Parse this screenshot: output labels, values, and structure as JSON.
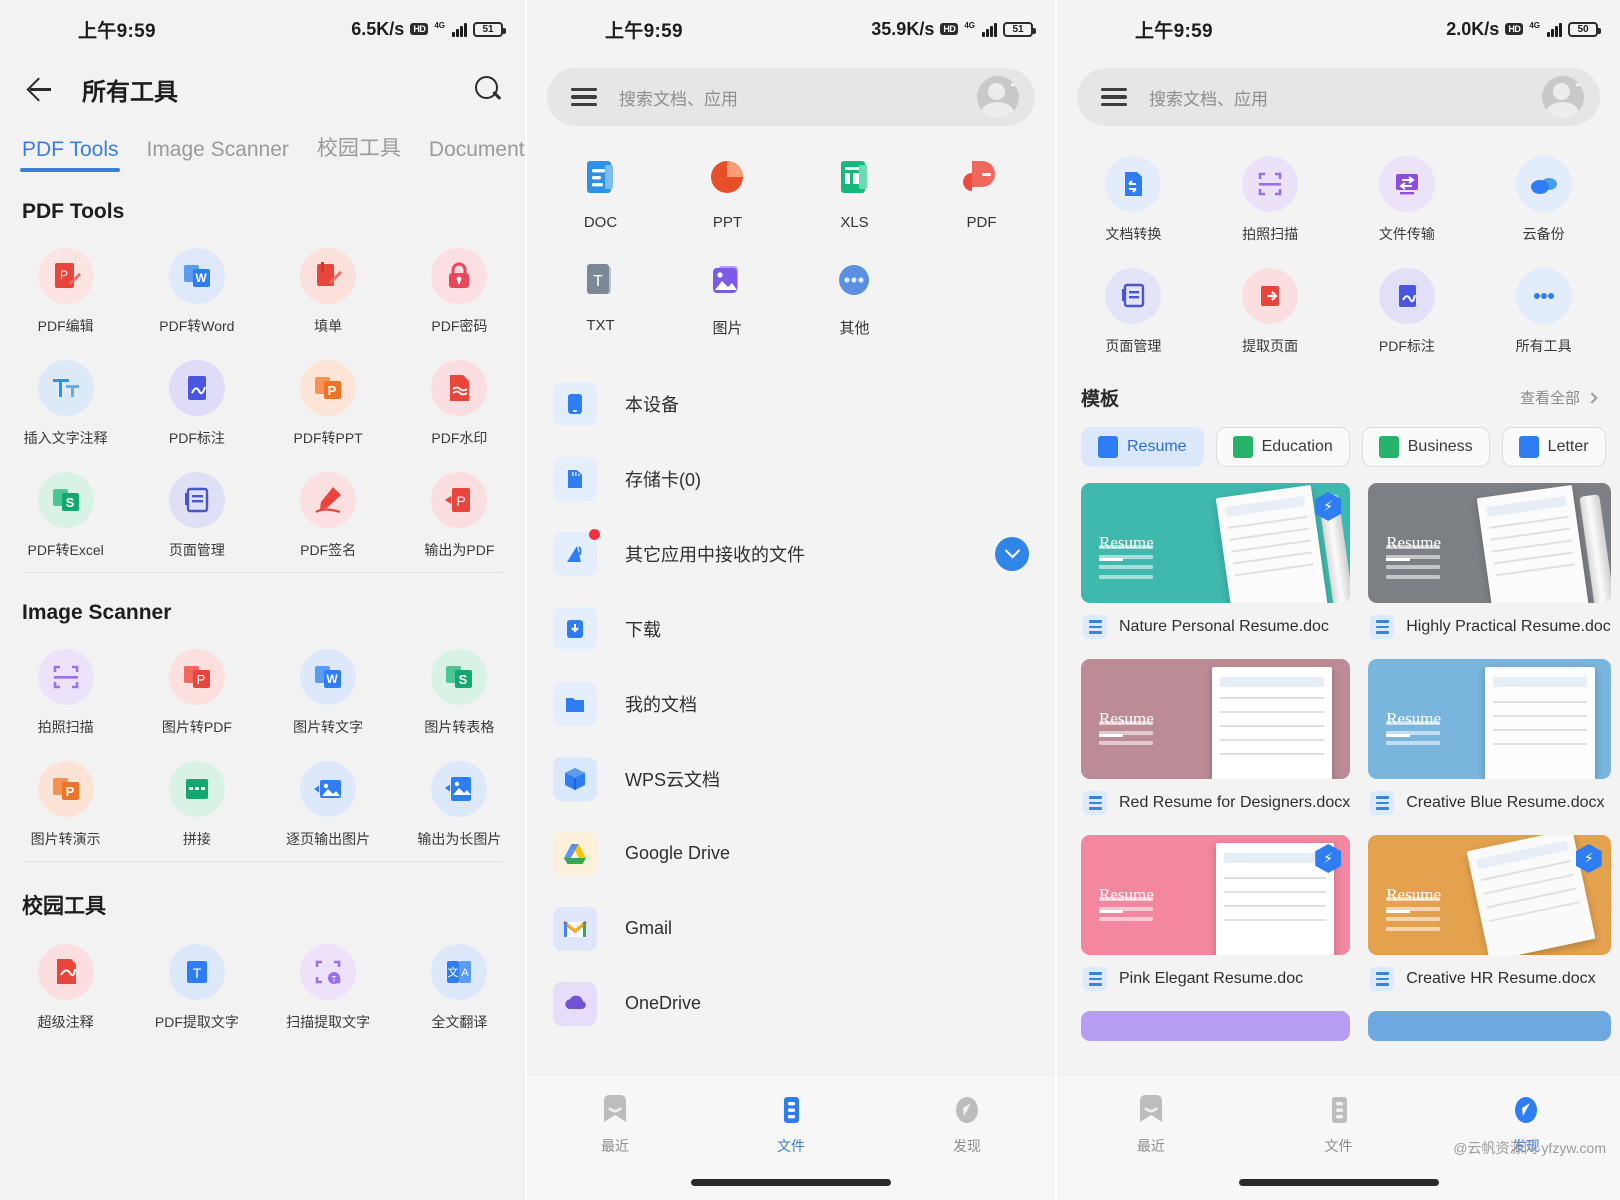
{
  "panel1": {
    "status": {
      "time": "上午9:59",
      "speed": "6.5K/s",
      "net_label": "HD",
      "gen": "4G",
      "battery": "51"
    },
    "header": {
      "title": "所有工具",
      "back_icon": "back-arrow-icon",
      "search_icon": "search-icon"
    },
    "tabs": [
      {
        "label": "PDF Tools",
        "active": true
      },
      {
        "label": "Image Scanner",
        "active": false
      },
      {
        "label": "校园工具",
        "active": false
      },
      {
        "label": "Document",
        "active": false
      }
    ],
    "sections": [
      {
        "title": "PDF Tools",
        "items": [
          {
            "label": "PDF编辑",
            "icon": "pdf-edit-icon"
          },
          {
            "label": "PDF转Word",
            "icon": "pdf-to-word-icon"
          },
          {
            "label": "填单",
            "icon": "fill-form-icon"
          },
          {
            "label": "PDF密码",
            "icon": "pdf-password-lock-icon"
          },
          {
            "label": "插入文字注释",
            "icon": "insert-text-annotation-icon"
          },
          {
            "label": "PDF标注",
            "icon": "pdf-annotate-icon"
          },
          {
            "label": "PDF转PPT",
            "icon": "pdf-to-ppt-icon"
          },
          {
            "label": "PDF水印",
            "icon": "pdf-watermark-icon"
          },
          {
            "label": "PDF转Excel",
            "icon": "pdf-to-excel-icon"
          },
          {
            "label": "页面管理",
            "icon": "page-manage-icon"
          },
          {
            "label": "PDF签名",
            "icon": "pdf-signature-pen-icon"
          },
          {
            "label": "输出为PDF",
            "icon": "export-pdf-icon"
          }
        ]
      },
      {
        "title": "Image Scanner",
        "items": [
          {
            "label": "拍照扫描",
            "icon": "camera-scan-icon"
          },
          {
            "label": "图片转PDF",
            "icon": "image-to-pdf-icon"
          },
          {
            "label": "图片转文字",
            "icon": "image-to-word-icon"
          },
          {
            "label": "图片转表格",
            "icon": "image-to-excel-icon"
          },
          {
            "label": "图片转演示",
            "icon": "image-to-ppt-icon"
          },
          {
            "label": "拼接",
            "icon": "stitch-icon"
          },
          {
            "label": "逐页输出图片",
            "icon": "page-to-image-icon"
          },
          {
            "label": "输出为长图片",
            "icon": "long-image-icon"
          }
        ]
      },
      {
        "title": "校园工具",
        "items": [
          {
            "label": "超级注释",
            "icon": "super-annotation-icon"
          },
          {
            "label": "PDF提取文字",
            "icon": "pdf-extract-text-icon"
          },
          {
            "label": "扫描提取文字",
            "icon": "scan-extract-text-icon"
          },
          {
            "label": "全文翻译",
            "icon": "translate-icon"
          }
        ]
      }
    ]
  },
  "panel2": {
    "status": {
      "time": "上午9:59",
      "speed": "35.9K/s",
      "net_label": "HD",
      "gen": "4G",
      "battery": "51"
    },
    "search": {
      "placeholder": "搜索文档、应用",
      "menu_icon": "hamburger-menu-icon",
      "avatar_icon": "user-avatar-sleep-icon"
    },
    "filetypes": [
      {
        "label": "DOC",
        "icon": "doc-file-icon"
      },
      {
        "label": "PPT",
        "icon": "ppt-file-icon"
      },
      {
        "label": "XLS",
        "icon": "xls-file-icon"
      },
      {
        "label": "PDF",
        "icon": "pdf-file-icon"
      },
      {
        "label": "TXT",
        "icon": "txt-file-icon"
      },
      {
        "label": "图片",
        "icon": "image-file-icon"
      },
      {
        "label": "其他",
        "icon": "other-file-icon"
      }
    ],
    "locations": [
      {
        "label": "本设备",
        "icon": "phone-icon",
        "badge": false,
        "action": null
      },
      {
        "label": "存储卡(0)",
        "icon": "sdcard-icon",
        "badge": false,
        "action": null
      },
      {
        "label": "其它应用中接收的文件",
        "icon": "received-files-icon",
        "badge": true,
        "action": "download-button"
      },
      {
        "label": "下载",
        "icon": "download-folder-icon",
        "badge": false,
        "action": null
      },
      {
        "label": "我的文档",
        "icon": "my-documents-folder-icon",
        "badge": false,
        "action": null
      },
      {
        "label": "WPS云文档",
        "icon": "wps-cloud-icon",
        "badge": false,
        "action": null
      },
      {
        "label": "Google Drive",
        "icon": "google-drive-icon",
        "badge": false,
        "action": null
      },
      {
        "label": "Gmail",
        "icon": "gmail-icon",
        "badge": false,
        "action": null
      },
      {
        "label": "OneDrive",
        "icon": "onedrive-icon",
        "badge": false,
        "action": null
      }
    ],
    "bottomnav": [
      {
        "label": "最近",
        "icon": "recent-icon",
        "active": false
      },
      {
        "label": "文件",
        "icon": "files-icon",
        "active": true
      },
      {
        "label": "发现",
        "icon": "discover-compass-icon",
        "active": false
      }
    ]
  },
  "panel3": {
    "status": {
      "time": "上午9:59",
      "speed": "2.0K/s",
      "net_label": "HD",
      "gen": "4G",
      "battery": "50"
    },
    "search": {
      "placeholder": "搜索文档、应用",
      "menu_icon": "hamburger-menu-icon",
      "avatar_icon": "user-avatar-sleep-icon"
    },
    "tools": [
      {
        "label": "文档转换",
        "icon": "doc-convert-icon"
      },
      {
        "label": "拍照扫描",
        "icon": "camera-scan-icon"
      },
      {
        "label": "文件传输",
        "icon": "file-transfer-icon"
      },
      {
        "label": "云备份",
        "icon": "cloud-backup-icon"
      },
      {
        "label": "页面管理",
        "icon": "page-manage-icon"
      },
      {
        "label": "提取页面",
        "icon": "extract-page-icon"
      },
      {
        "label": "PDF标注",
        "icon": "pdf-annotate-icon"
      },
      {
        "label": "所有工具",
        "icon": "all-tools-more-icon"
      }
    ],
    "templates": {
      "title": "模板",
      "see_all": "查看全部",
      "chips": [
        {
          "label": "Resume",
          "active": true,
          "color": "#2f7df2"
        },
        {
          "label": "Education",
          "active": false,
          "color": "#27b36a"
        },
        {
          "label": "Business",
          "active": false,
          "color": "#27b36a"
        },
        {
          "label": "Letter",
          "active": false,
          "color": "#2f7df2"
        }
      ],
      "cards": [
        {
          "name": "Nature Personal Resume.doc",
          "thumb_title": "Resume",
          "bg": "#3fb8ad",
          "badge": true
        },
        {
          "name": "Highly Practical Resume.doc",
          "thumb_title": "Resume",
          "bg": "#7c7f84",
          "badge": false
        },
        {
          "name": "Red Resume for Designers.docx",
          "thumb_title": "Resume",
          "bg": "#bb8b96",
          "badge": false
        },
        {
          "name": "Creative Blue Resume.docx",
          "thumb_title": "Resume",
          "bg": "#79b5dd",
          "badge": false
        },
        {
          "name": "Pink Elegant Resume.doc",
          "thumb_title": "Resume",
          "bg": "#f2879f",
          "badge": true
        },
        {
          "name": "Creative HR Resume.docx",
          "thumb_title": "Resume",
          "bg": "#e5a24e",
          "badge": true
        }
      ]
    },
    "bottomnav": [
      {
        "label": "最近",
        "icon": "recent-icon",
        "active": false
      },
      {
        "label": "文件",
        "icon": "files-icon",
        "active": false
      },
      {
        "label": "发现",
        "icon": "discover-compass-icon",
        "active": true
      }
    ],
    "watermark": "@云帆资源网 yfzyw.com"
  }
}
